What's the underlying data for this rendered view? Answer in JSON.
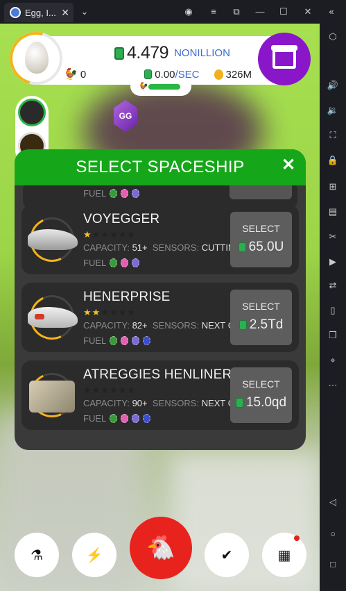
{
  "window": {
    "tab_title": "Egg, I...",
    "tab_close": "✕"
  },
  "titlebar_icons": [
    "account-icon",
    "menu-icon",
    "external-link-icon",
    "minimize-icon",
    "maximize-icon",
    "close-icon",
    "collapse-icon"
  ],
  "sidebar_icons": [
    "settings-hex-icon",
    "volume-up-icon",
    "volume-down-icon",
    "screen-icon",
    "lock-icon",
    "add-icon",
    "apk-icon",
    "scissors-icon",
    "record-icon",
    "sync-icon",
    "phone-icon",
    "layers-icon",
    "location-icon",
    "more-icon",
    "back-icon",
    "home-icon",
    "recents-icon"
  ],
  "hud": {
    "money": "4.479",
    "money_unit": "NONILLION",
    "chickens": "0",
    "rate": "0.00",
    "rate_unit": "/SEC",
    "golden_eggs": "326M"
  },
  "modal": {
    "title": "SELECT SPACESHIP",
    "close": "✕",
    "partial_fuel_label": "FUEL",
    "ships": [
      {
        "name": "VOYEGGER",
        "stars": 1,
        "capacity_label": "CAPACITY:",
        "capacity": "51+",
        "sensors_label": "SENSORS:",
        "sensors": "CUTTING EDGE",
        "fuel_label": "FUEL",
        "fuel": [
          "#3a9a3a",
          "#e45fb0",
          "#7a6cd8"
        ],
        "select_label": "SELECT",
        "price": "65.0U",
        "image": "ship-gray"
      },
      {
        "name": "HENERPRISE",
        "stars": 2,
        "capacity_label": "CAPACITY:",
        "capacity": "82+",
        "sensors_label": "SENSORS:",
        "sensors": "NEXT GENERATION",
        "fuel_label": "FUEL",
        "fuel": [
          "#3a9a3a",
          "#e45fb0",
          "#7a6cd8",
          "#3b4ed0"
        ],
        "select_label": "SELECT",
        "price": "2.5Td",
        "image": "ship-red"
      },
      {
        "name": "ATREGGIES HENLINER",
        "stars": 0,
        "capacity_label": "CAPACITY:",
        "capacity": "90+",
        "sensors_label": "SENSORS:",
        "sensors": "NEXT GENERATION",
        "fuel_label": "FUEL",
        "fuel": [
          "#3a9a3a",
          "#e45fb0",
          "#7a6cd8",
          "#3b4ed0"
        ],
        "select_label": "SELECT",
        "price": "15.0qd",
        "image": "ship-block"
      }
    ]
  },
  "bottom_bar": [
    {
      "name": "research-button",
      "icon": "⚗"
    },
    {
      "name": "boost-button",
      "icon": "⚡"
    },
    {
      "name": "hatch-chicken-button",
      "icon": "🐔"
    },
    {
      "name": "missions-button",
      "icon": "✔"
    },
    {
      "name": "menu-grid-button",
      "icon": "▦"
    }
  ]
}
